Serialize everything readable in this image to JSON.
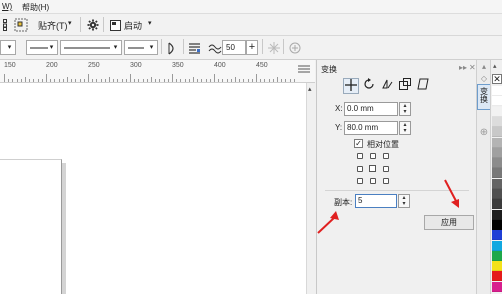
{
  "menubar": {
    "items": [
      "W)",
      "帮助(H)"
    ]
  },
  "toolbar1": {
    "align_label": "贴齐(T)",
    "launch_label": "启动",
    "dropdown_arrow": "▾",
    "icons": [
      "grid-icon",
      "snap-icon",
      "gear-icon",
      "launch-icon"
    ]
  },
  "toolbar2": {
    "outline_width_value": "50",
    "plus_label": "+",
    "minus_label": "−",
    "dropdown_arrow": "▾"
  },
  "ruler": {
    "labels": [
      "150",
      "200",
      "250",
      "300",
      "350",
      "400",
      "450"
    ]
  },
  "docker": {
    "title": "变换",
    "header_buttons": [
      "▸▸",
      "✕"
    ],
    "x_label": "X:",
    "x_value": "0.0 mm",
    "y_label": "Y:",
    "y_value": "80.0 mm",
    "relative_position_label": "相对位置",
    "relative_position_checked": true,
    "copies_label": "副本:",
    "copies_value": "5",
    "apply_label": "应用",
    "spin_up": "▴",
    "spin_down": "▾"
  },
  "side_tabs": {
    "transform_tab": "变换",
    "scroll_up": "▴",
    "add": "⊕"
  },
  "palette": {
    "no_color_symbol": "✕",
    "colors": [
      "#ffffff",
      "#ffffff",
      "#f2f2f2",
      "#dcdcdc",
      "#c8c8c8",
      "#b4b4b4",
      "#a0a0a0",
      "#8c8c8c",
      "#787878",
      "#646464",
      "#505050",
      "#3c3c3c",
      "#1e1e1e",
      "#000000",
      "#1f3fd6",
      "#12a8e0",
      "#1fa84a",
      "#f4e21a",
      "#e41b1b",
      "#d81f8e"
    ]
  },
  "annotation": {
    "arrow_color": "#e02020"
  }
}
